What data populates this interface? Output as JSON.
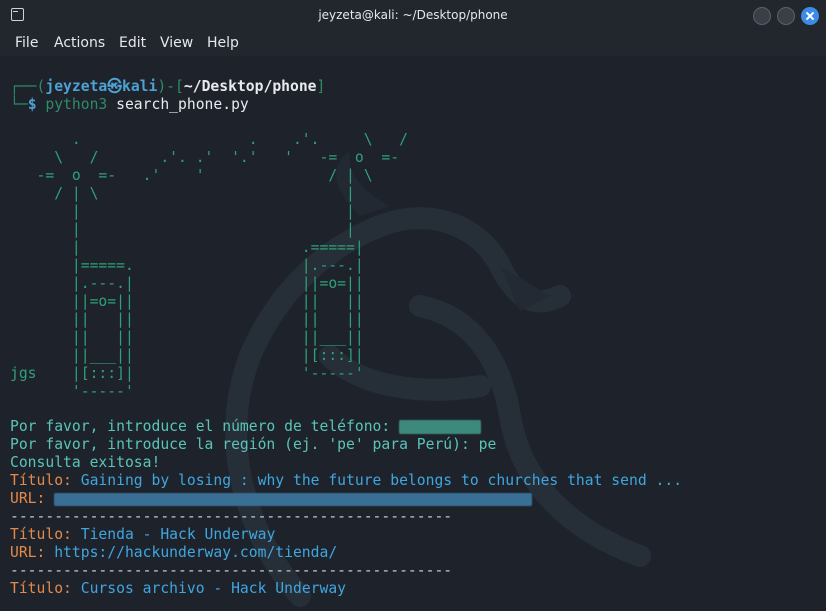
{
  "window": {
    "title": "jeyzeta@kali: ~/Desktop/phone"
  },
  "menu": [
    "File",
    "Actions",
    "Edit",
    "View",
    "Help"
  ],
  "prompt": {
    "open": "┌──(",
    "user": "jeyzeta",
    "at_symbol": "㉿",
    "host": "kali",
    "sep": ")-[",
    "path": "~/Desktop/phone",
    "close": "]",
    "line2_prefix": "└─",
    "dollar": "$ ",
    "cmd_name": "python3",
    "cmd_arg": " search_phone.py"
  },
  "ascii_art": "       .                   .    .'.     \\   /\n     \\   /       .'. .'  '.'   '   -=  o  =-\n   -=  o  =-   .'    '              / | \\\n     / | \\                            |\n       |                              |\n       |                              |\n       |                         .=====|\n       |=====.                   |.---.|\n       |.---.|                   ||=o=||\n       ||=o=||                   ||   ||\n       ||   ||                   ||   ||\n       ||   ||                   ||___||\n       ||___||                   |[:::]|\njgs    |[:::]|                   '-----'\n       '-----'",
  "output": {
    "phone_prompt": "Por favor, introduce el número de teléfono: ",
    "region_prompt": "Por favor, introduce la región (ej. 'pe' para Perú): pe",
    "success": "Consulta exitosa!",
    "results": [
      {
        "title_label": "Título: ",
        "title": "Gaining by losing : why the future belongs to churches that send ...",
        "url_label": "URL: ",
        "url": ""
      },
      {
        "title_label": "Título: ",
        "title": "Tienda - Hack Underway",
        "url_label": "URL: ",
        "url": "https://hackunderway.com/tienda/"
      },
      {
        "title_label": "Título: ",
        "title": "Cursos archivo - Hack Underway"
      }
    ],
    "separator": "--------------------------------------------------"
  },
  "colors": {
    "prompt_frame": "#2e8b67",
    "prompt_user": "#4ea1d3",
    "output_text": "#5ac4b9",
    "title_label": "#e5894a",
    "link": "#3fa6e0",
    "close_button": "#3d8be6"
  },
  "icons": [
    "terminal-icon",
    "minimize-icon",
    "maximize-icon",
    "close-icon",
    "kali-dragon-watermark"
  ]
}
